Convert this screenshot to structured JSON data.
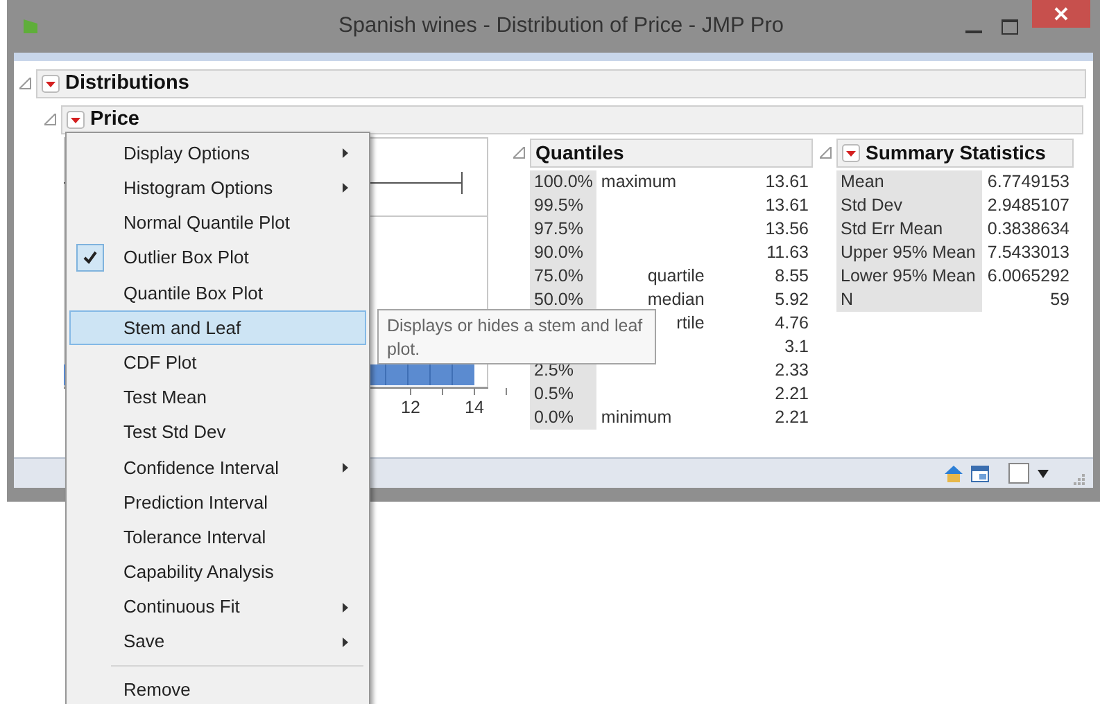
{
  "window": {
    "title": "Spanish wines - Distribution of Price - JMP Pro"
  },
  "report": {
    "title": "Distributions",
    "expanded": true,
    "menu_button": true,
    "variable": {
      "title": "Price",
      "expanded": true,
      "menu_button": true,
      "plot": {
        "tick_labels": [
          "12",
          "14"
        ]
      },
      "quantiles": {
        "title": "Quantiles",
        "expanded": true,
        "menu_button": false,
        "rows": [
          {
            "percent": "100.0%",
            "name": "maximum",
            "value": "13.61",
            "indented": false
          },
          {
            "percent": "99.5%",
            "value": "13.61"
          },
          {
            "percent": "97.5%",
            "value": "13.56"
          },
          {
            "percent": "90.0%",
            "value": "11.63"
          },
          {
            "percent": "75.0%",
            "name": "quartile",
            "value": "8.55",
            "indented": true
          },
          {
            "percent": "50.0%",
            "name": "median",
            "value": "5.92",
            "indented": true
          },
          {
            "name": "rtile",
            "value": "4.76",
            "indented": true
          },
          {
            "value": "3.1"
          },
          {
            "percent": "2.5%",
            "value": "2.33"
          },
          {
            "percent": "0.5%",
            "value": "2.21"
          },
          {
            "percent": "0.0%",
            "name": "minimum",
            "value": "2.21",
            "indented": false
          }
        ]
      },
      "summary": {
        "title": "Summary Statistics",
        "expanded": true,
        "menu_button": true,
        "rows": [
          {
            "label": "Mean",
            "value": "6.7749153"
          },
          {
            "label": "Std Dev",
            "value": "2.9485107"
          },
          {
            "label": "Std Err Mean",
            "value": "0.3838634"
          },
          {
            "label": "Upper 95% Mean",
            "value": "7.5433013"
          },
          {
            "label": "Lower 95% Mean",
            "value": "6.0065292"
          },
          {
            "label": "N",
            "value": "59"
          }
        ]
      }
    }
  },
  "menu": {
    "items": [
      {
        "kind": "submenu",
        "label": "Display Options",
        "checked": false,
        "selected": false
      },
      {
        "kind": "submenu",
        "label": "Histogram Options",
        "checked": false,
        "selected": false
      },
      {
        "kind": "item",
        "label": "Normal Quantile Plot",
        "checked": false,
        "selected": false
      },
      {
        "kind": "item",
        "label": "Outlier Box Plot",
        "checked": true,
        "selected": false
      },
      {
        "kind": "item",
        "label": "Quantile Box Plot",
        "checked": false,
        "selected": false
      },
      {
        "kind": "item",
        "label": "Stem and Leaf",
        "checked": false,
        "selected": true
      },
      {
        "kind": "item",
        "label": "CDF Plot",
        "checked": false,
        "selected": false
      },
      {
        "kind": "item",
        "label": "Test Mean",
        "checked": false,
        "selected": false
      },
      {
        "kind": "item",
        "label": "Test Std Dev",
        "checked": false,
        "selected": false
      },
      {
        "kind": "submenu",
        "label": "Confidence Interval",
        "checked": false,
        "selected": false
      },
      {
        "kind": "item",
        "label": "Prediction Interval",
        "checked": false,
        "selected": false
      },
      {
        "kind": "item",
        "label": "Tolerance Interval",
        "checked": false,
        "selected": false
      },
      {
        "kind": "item",
        "label": "Capability Analysis",
        "checked": false,
        "selected": false
      },
      {
        "kind": "submenu",
        "label": "Continuous Fit",
        "checked": false,
        "selected": false
      },
      {
        "kind": "submenu",
        "label": "Save",
        "checked": false,
        "selected": false
      },
      {
        "kind": "separator"
      },
      {
        "kind": "item",
        "label": "Remove",
        "checked": false,
        "selected": false
      }
    ]
  },
  "tooltip": {
    "text": "Displays or hides a stem and leaf plot."
  }
}
